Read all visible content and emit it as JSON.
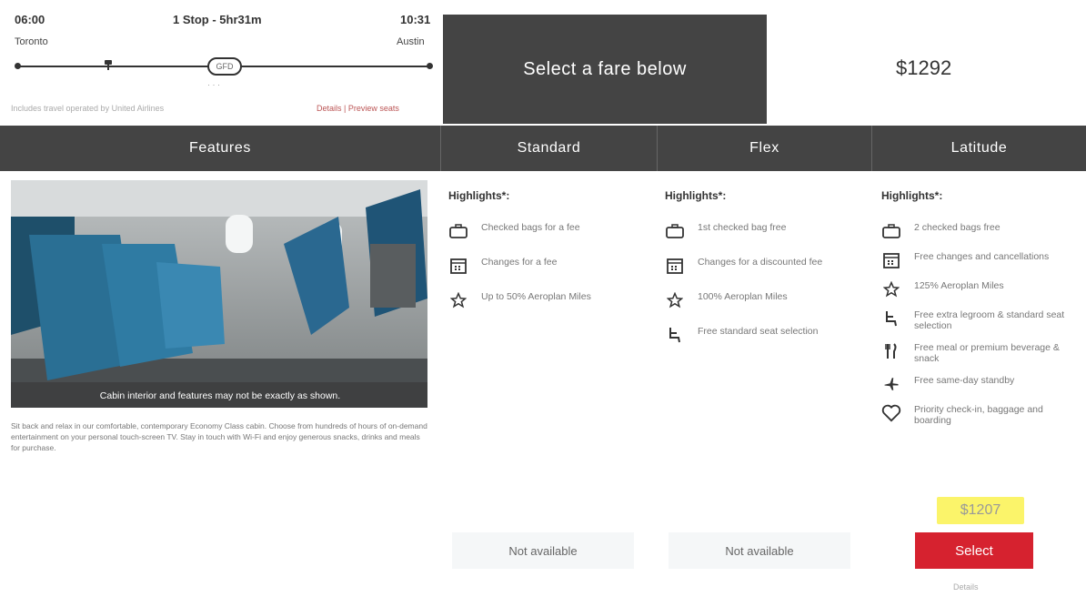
{
  "flight": {
    "departure_time": "06:00",
    "stops_duration": "1 Stop - 5hr31m",
    "arrival_time": "10:31",
    "origin": "Toronto",
    "destination": "Austin",
    "stop_code": "GFD",
    "note": "Includes travel operated by United Airlines",
    "details_link": "Details | Preview seats"
  },
  "fare_header": {
    "select_label": "Select a fare below",
    "price": "$1292"
  },
  "columns": {
    "features": "Features",
    "standard": "Standard",
    "flex": "Flex",
    "latitude": "Latitude"
  },
  "features": {
    "image_caption": "Cabin interior and features may not be exactly as shown.",
    "description": "Sit back and relax in our comfortable, contemporary Economy Class cabin. Choose from hundreds of hours of on-demand entertainment on your personal touch-screen TV. Stay in touch with Wi-Fi and enjoy generous snacks, drinks and meals for purchase."
  },
  "highlights_label": "Highlights*:",
  "standard": {
    "items": [
      {
        "icon": "luggage-icon",
        "text": "Checked bags for a fee"
      },
      {
        "icon": "calendar-icon",
        "text": "Changes for a fee"
      },
      {
        "icon": "star-icon",
        "text": "Up to 50% Aeroplan Miles"
      }
    ],
    "availability": "Not available"
  },
  "flex": {
    "items": [
      {
        "icon": "luggage-icon",
        "text": "1st checked bag free"
      },
      {
        "icon": "calendar-icon",
        "text": "Changes for a discounted fee"
      },
      {
        "icon": "star-icon",
        "text": "100% Aeroplan Miles"
      },
      {
        "icon": "seat-icon",
        "text": "Free standard seat selection"
      }
    ],
    "availability": "Not available"
  },
  "latitude": {
    "items": [
      {
        "icon": "luggage-icon",
        "text": "2 checked bags free"
      },
      {
        "icon": "calendar-icon",
        "text": "Free changes and cancellations"
      },
      {
        "icon": "star-icon",
        "text": "125% Aeroplan Miles"
      },
      {
        "icon": "seat-icon",
        "text": "Free extra legroom & standard seat selection"
      },
      {
        "icon": "meal-icon",
        "text": "Free meal or premium beverage & snack"
      },
      {
        "icon": "plane-icon",
        "text": "Free same-day standby"
      },
      {
        "icon": "heart-icon",
        "text": "Priority check-in, baggage and boarding"
      }
    ],
    "price": "$1207",
    "select_label": "Select",
    "details": "Details"
  },
  "colors": {
    "header_bg": "#444444",
    "select_button": "#d6222f",
    "price_highlight": "#fbf46a"
  }
}
